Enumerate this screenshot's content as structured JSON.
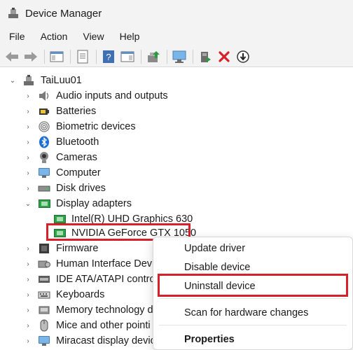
{
  "window": {
    "title": "Device Manager"
  },
  "menubar": {
    "items": [
      "File",
      "Action",
      "View",
      "Help"
    ]
  },
  "tree": {
    "root": "TaiLuu01",
    "categories": [
      "Audio inputs and outputs",
      "Batteries",
      "Biometric devices",
      "Bluetooth",
      "Cameras",
      "Computer",
      "Disk drives",
      "Display adapters",
      "Firmware",
      "Human Interface Devic",
      "IDE ATA/ATAPI controlle",
      "Keyboards",
      "Memory technology d",
      "Mice and other pointi",
      "Miracast display devic"
    ],
    "display_children": [
      "Intel(R) UHD Graphics 630",
      "NVIDIA GeForce GTX 1050"
    ]
  },
  "context_menu": {
    "update": "Update driver",
    "disable": "Disable device",
    "uninstall": "Uninstall device",
    "scan": "Scan for hardware changes",
    "properties": "Properties"
  },
  "colors": {
    "highlight": "#d8202a",
    "titlebar": "#f3f3f3"
  }
}
